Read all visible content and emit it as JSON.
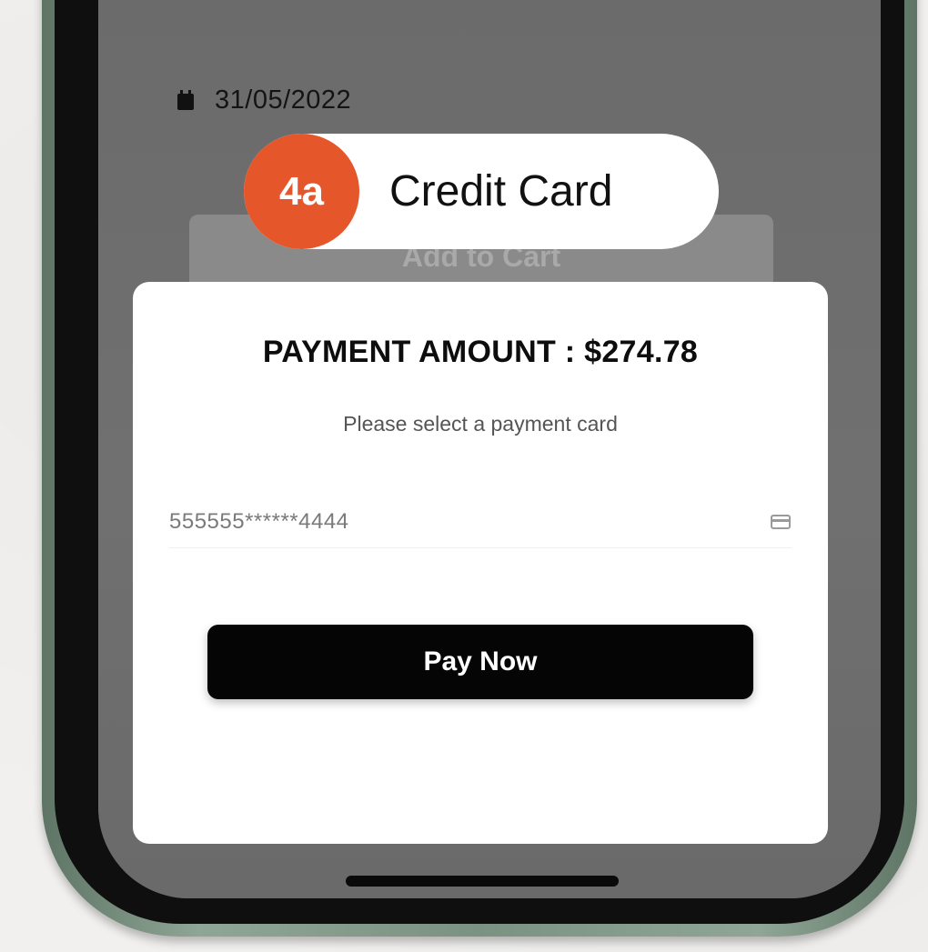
{
  "product": {
    "date": "31/05/2022",
    "add_to_cart_label": "Add to Cart"
  },
  "step_badge": {
    "number": "4a",
    "label": "Credit Card"
  },
  "payment_sheet": {
    "title": "PAYMENT AMOUNT : $274.78",
    "subtitle": "Please select a payment card",
    "card_number": "555555******4444",
    "pay_button_label": "Pay Now"
  },
  "icons": {
    "calendar": "calendar-icon",
    "card": "credit-card-icon"
  },
  "colors": {
    "accent": "#e5572b",
    "phone_frame": "#7b9282",
    "button": "#050505"
  }
}
